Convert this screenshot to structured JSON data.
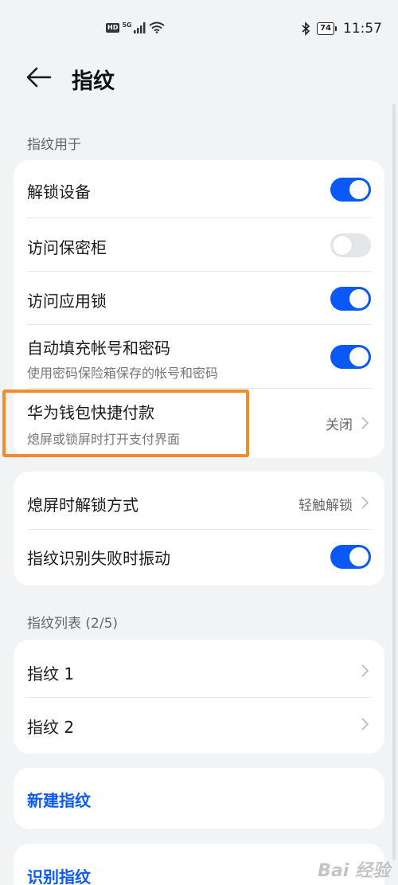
{
  "status_bar": {
    "net_badge": "HD",
    "net_type": "5G",
    "battery": "74",
    "time": "11:57"
  },
  "header": {
    "title": "指纹"
  },
  "sections": {
    "usage_label": "指纹用于",
    "list_label": "指纹列表 (2/5)"
  },
  "usage": {
    "unlock_device": {
      "label": "解锁设备",
      "on": true
    },
    "safe": {
      "label": "访问保密柜",
      "on": false
    },
    "app_lock": {
      "label": "访问应用锁",
      "on": true
    },
    "autofill": {
      "label": "自动填充帐号和密码",
      "sub": "使用密码保险箱保存的帐号和密码",
      "on": true
    },
    "wallet": {
      "label": "华为钱包快捷付款",
      "sub": "熄屏或锁屏时打开支付界面",
      "value": "关闭"
    }
  },
  "screen_off": {
    "unlock_mode": {
      "label": "熄屏时解锁方式",
      "value": "轻触解锁"
    },
    "vibrate": {
      "label": "指纹识别失败时振动",
      "on": true
    }
  },
  "fingerprints": [
    {
      "label": "指纹 1"
    },
    {
      "label": "指纹 2"
    }
  ],
  "actions": {
    "new": "新建指纹",
    "identify": "识别指纹"
  },
  "watermark": "Bai 经验",
  "colors": {
    "accent": "#0a59f7",
    "highlight": "#f58a2a"
  }
}
